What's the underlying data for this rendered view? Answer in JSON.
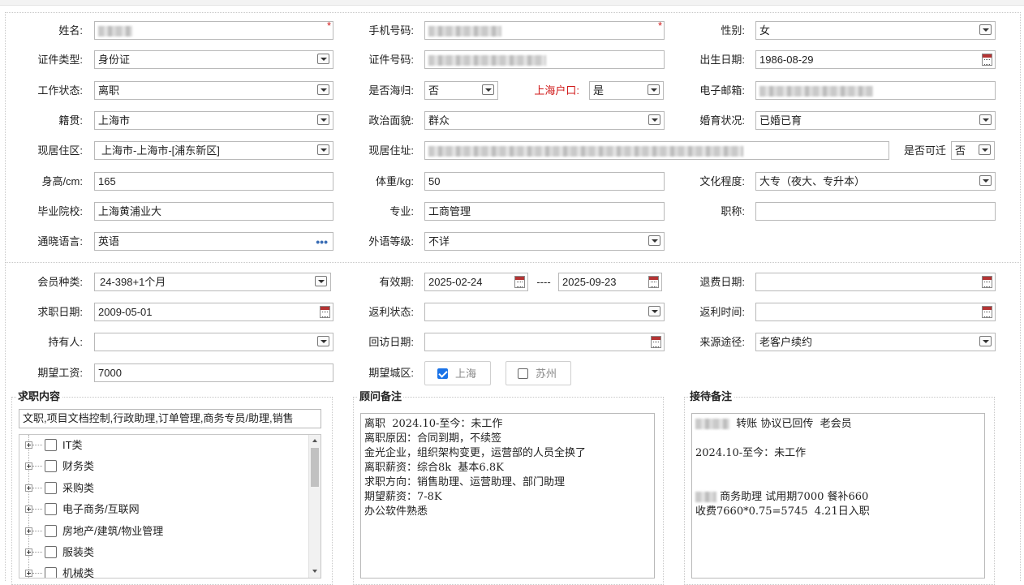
{
  "labels": {
    "name": "姓名:",
    "phone": "手机号码:",
    "gender": "性别:",
    "id_type": "证件类型:",
    "id_number": "证件号码:",
    "birth_date": "出生日期:",
    "work_status": "工作状态:",
    "overseas_returnee": "是否海归:",
    "shanghai_hukou": "上海户口:",
    "email": "电子邮箱:",
    "native_place": "籍贯:",
    "political_status": "政治面貌:",
    "marital_status": "婚育状况:",
    "residence_area": "现居住区:",
    "residence_address": "现居住址:",
    "relocatable": "是否可迁",
    "height": "身高/cm:",
    "weight": "体重/kg:",
    "education": "文化程度:",
    "school": "毕业院校:",
    "major": "专业:",
    "title": "职称:",
    "language": "通晓语言:",
    "foreign_level": "外语等级:",
    "member_type": "会员种类:",
    "validity": "有效期:",
    "refund_date": "退费日期:",
    "job_seek_date": "求职日期:",
    "rebate_status": "返利状态:",
    "rebate_time": "返利时间:",
    "holder": "持有人:",
    "revisit_date": "回访日期:",
    "source": "来源途径:",
    "expected_salary": "期望工资:",
    "expected_city": "期望城区:"
  },
  "values": {
    "name": "",
    "phone": "",
    "gender": "女",
    "id_type": "身份证",
    "id_number": "",
    "birth_date": "1986-08-29",
    "work_status": "离职",
    "overseas_returnee": "否",
    "shanghai_hukou": "是",
    "email": "",
    "native_place": "上海市",
    "political_status": "群众",
    "marital_status": "已婚已育",
    "residence_area": "上海市-上海市-[浦东新区]",
    "residence_address": "",
    "relocatable": "否",
    "height": "165",
    "weight": "50",
    "education": "大专（夜大、专升本）",
    "school": "上海黄浦业大",
    "major": "工商管理",
    "title": "",
    "language": "英语",
    "foreign_level": "不详",
    "member_type": "24-398+1个月",
    "validity_start": "2025-02-24",
    "validity_sep": "----",
    "validity_end": "2025-09-23",
    "refund_date": "",
    "job_seek_date": "2009-05-01",
    "rebate_status": "",
    "rebate_time": "",
    "holder": "",
    "revisit_date": "",
    "source": "老客户续约",
    "expected_salary": "7000"
  },
  "required_mark": "*",
  "more_icon": "•••",
  "city_options": [
    {
      "label": "上海",
      "checked": true
    },
    {
      "label": "苏州",
      "checked": false
    }
  ],
  "job_content": {
    "legend": "求职内容",
    "selected_text": "文职,项目文档控制,行政助理,订单管理,商务专员/助理,销售",
    "tree_items": [
      "IT类",
      "财务类",
      "采购类",
      "电子商务/互联网",
      "房地产/建筑/物业管理",
      "服装类",
      "机械类"
    ]
  },
  "advisor_notes": {
    "legend": "顾问备注",
    "lines": [
      "离职  2024.10-至今：未工作",
      "离职原因：合同到期，不续签",
      "金光企业，组织架构变更，运营部的人员全换了",
      "离职薪资：综合8k  基本6.8K",
      "求职方向：销售助理、运营助理、部门助理",
      "期望薪资：7-8K",
      "办公软件熟悉"
    ]
  },
  "reception_notes": {
    "legend": "接待备注",
    "line1": "转账 协议已回传  老会员",
    "line2": "2024.10-至今：未工作",
    "line3": "商务助理 试用期7000 餐补660",
    "line4": "收费7660*0.75=5745  4.21日入职"
  },
  "colors": {
    "accent_blue": "#1a73e8",
    "required_red": "#d01818",
    "calendar_red": "#b43434",
    "more_icon_blue": "#3a6db5"
  }
}
